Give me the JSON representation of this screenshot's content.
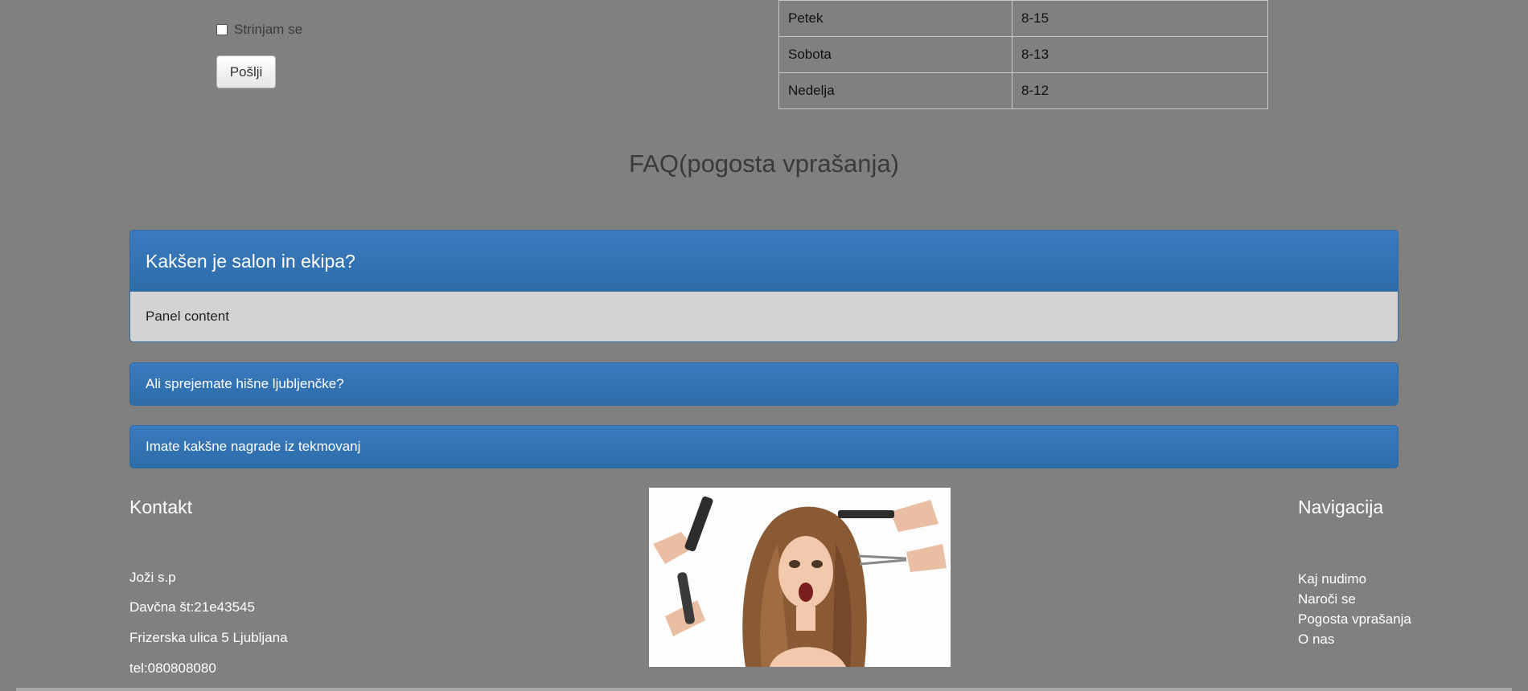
{
  "form": {
    "agree_label": "Strinjam se",
    "agree_checked": false,
    "send_label": "Pošlji"
  },
  "hours": [
    {
      "day": "Petek",
      "time": "8-15"
    },
    {
      "day": "Sobota",
      "time": "8-13"
    },
    {
      "day": "Nedelja",
      "time": "8-12"
    }
  ],
  "faq": {
    "title": "FAQ(pogosta vprašanja)",
    "panels": [
      {
        "question": "Kakšen je salon in ekipa?",
        "content": "Panel content",
        "expanded": true
      },
      {
        "question": "Ali sprejemate hišne ljubljenčke?",
        "expanded": false
      },
      {
        "question": "Imate kakšne nagrade iz tekmovanj",
        "expanded": false
      }
    ]
  },
  "footer": {
    "contact_heading": "Kontakt",
    "contact_lines": [
      "Joži s.p",
      "Davčna št:21e43545",
      "Frizerska ulica 5 Ljubljana",
      "tel:080808080"
    ],
    "nav_heading": "Navigacija",
    "nav_items": [
      "Kaj nudimo",
      "Naroči se",
      "Pogosta vprašanja",
      "O nas"
    ]
  },
  "colors": {
    "background": "#808080",
    "panel_header": "#337ab7",
    "panel_body": "#d4d3d4"
  }
}
